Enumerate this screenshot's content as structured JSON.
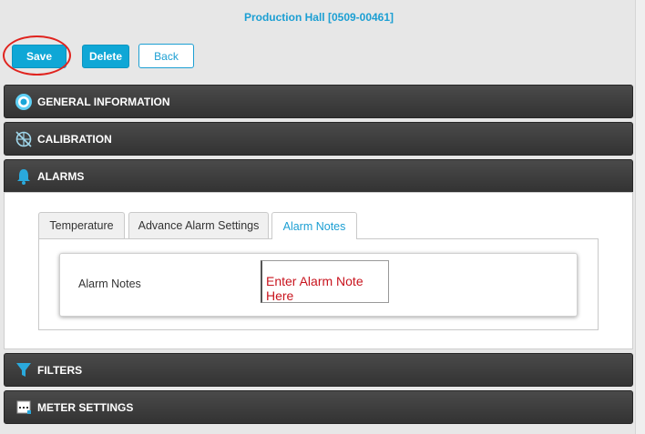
{
  "page": {
    "title": "Production Hall [0509-00461]"
  },
  "toolbar": {
    "save_label": "Save",
    "delete_label": "Delete",
    "back_label": "Back"
  },
  "sections": {
    "general": "GENERAL INFORMATION",
    "calibration": "CALIBRATION",
    "alarms": "ALARMS",
    "filters": "FILTERS",
    "meter": "METER SETTINGS"
  },
  "tabs": {
    "temperature": "Temperature",
    "advance": "Advance Alarm Settings",
    "notes": "Alarm Notes"
  },
  "alarm_notes": {
    "label": "Alarm Notes",
    "placeholder": "Enter Alarm Note Here",
    "value": ""
  },
  "icons": {
    "general": "info-circle-icon",
    "calibration": "compass-icon",
    "alarms": "bell-icon",
    "filters": "funnel-icon",
    "meter": "meter-icon"
  },
  "colors": {
    "accent": "#1c9fd3",
    "button_bg": "#0fa7d6",
    "header_bg": "#3b3b3b",
    "placeholder": "#c8141e",
    "annotation_ring": "#e0241f"
  }
}
